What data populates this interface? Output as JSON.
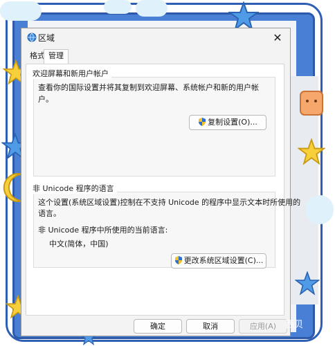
{
  "window": {
    "title": "区域",
    "close_glyph": "✕"
  },
  "tabs": [
    {
      "label": "格式"
    },
    {
      "label": "管理"
    }
  ],
  "welcome": {
    "title": "欢迎屏幕和新用户帐户",
    "description": "查看你的国际设置并将其复制到欢迎屏幕、系统帐户和新的用户帐户。",
    "copy_button": "复制设置(O)..."
  },
  "non_unicode": {
    "title": "非 Unicode 程序的语言",
    "description_line1": "这个设置(系统区域设置)控制在不支持 Unicode 的程序中显示文本时所使用的",
    "description_line2": "语言。",
    "current_label": "非 Unicode 程序中所使用的当前语言:",
    "current_value": "中文(简体，中国)",
    "change_button": "更改系统区域设置(C)..."
  },
  "footer": {
    "ok": "确定",
    "cancel": "取消",
    "apply": "应用(A)"
  },
  "watermark": "西贝",
  "colors": {
    "frame_blue": "#4a7fd6",
    "dialog_bg": "#f3f3f3",
    "panel_bg": "#ffffff",
    "disabled_text": "#9a9a9a"
  }
}
